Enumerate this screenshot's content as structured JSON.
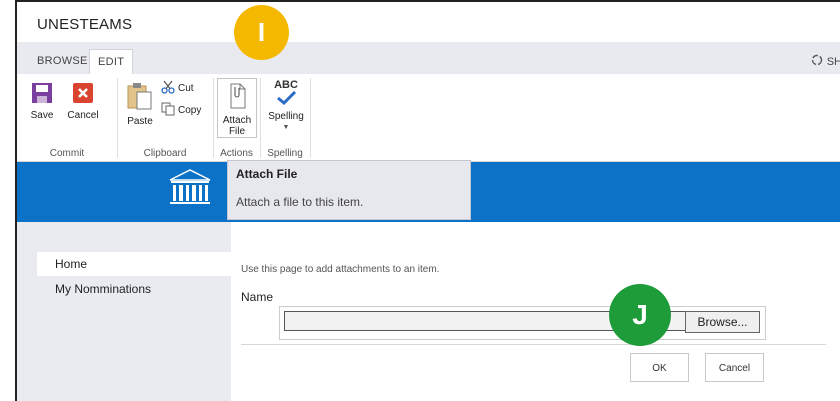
{
  "site": {
    "title": "UNESTEAMS"
  },
  "tabs": [
    {
      "label": "BROWSE"
    },
    {
      "label": "EDIT"
    }
  ],
  "share_label": "SH",
  "ribbon": {
    "commit": {
      "label": "Commit",
      "save": "Save",
      "cancel": "Cancel"
    },
    "clipboard": {
      "label": "Clipboard",
      "paste": "Paste",
      "cut": "Cut",
      "copy": "Copy"
    },
    "actions": {
      "label": "Actions",
      "attach_file_line1": "Attach",
      "attach_file_line2": "File"
    },
    "spelling": {
      "label": "Spelling",
      "button": "Spelling",
      "abc": "ABC"
    }
  },
  "tooltip": {
    "title": "Attach File",
    "description": "Attach a file to this item."
  },
  "nav": {
    "items": [
      {
        "label": "Home"
      },
      {
        "label": "My Nomminations"
      }
    ]
  },
  "form": {
    "intro": "Use this page to add attachments to an item.",
    "name_label": "Name",
    "file_value": "",
    "browse_label": "Browse...",
    "ok_label": "OK",
    "cancel_label": "Cancel"
  },
  "callouts": {
    "i": "I",
    "j": "J"
  },
  "colors": {
    "blue_band": "#0c72c8",
    "callout_i": "#f5b800",
    "callout_j": "#1f9c3a",
    "save_icon": "#7b3fa0",
    "cancel_icon": "#d9432f",
    "check": "#2a6cc7"
  }
}
